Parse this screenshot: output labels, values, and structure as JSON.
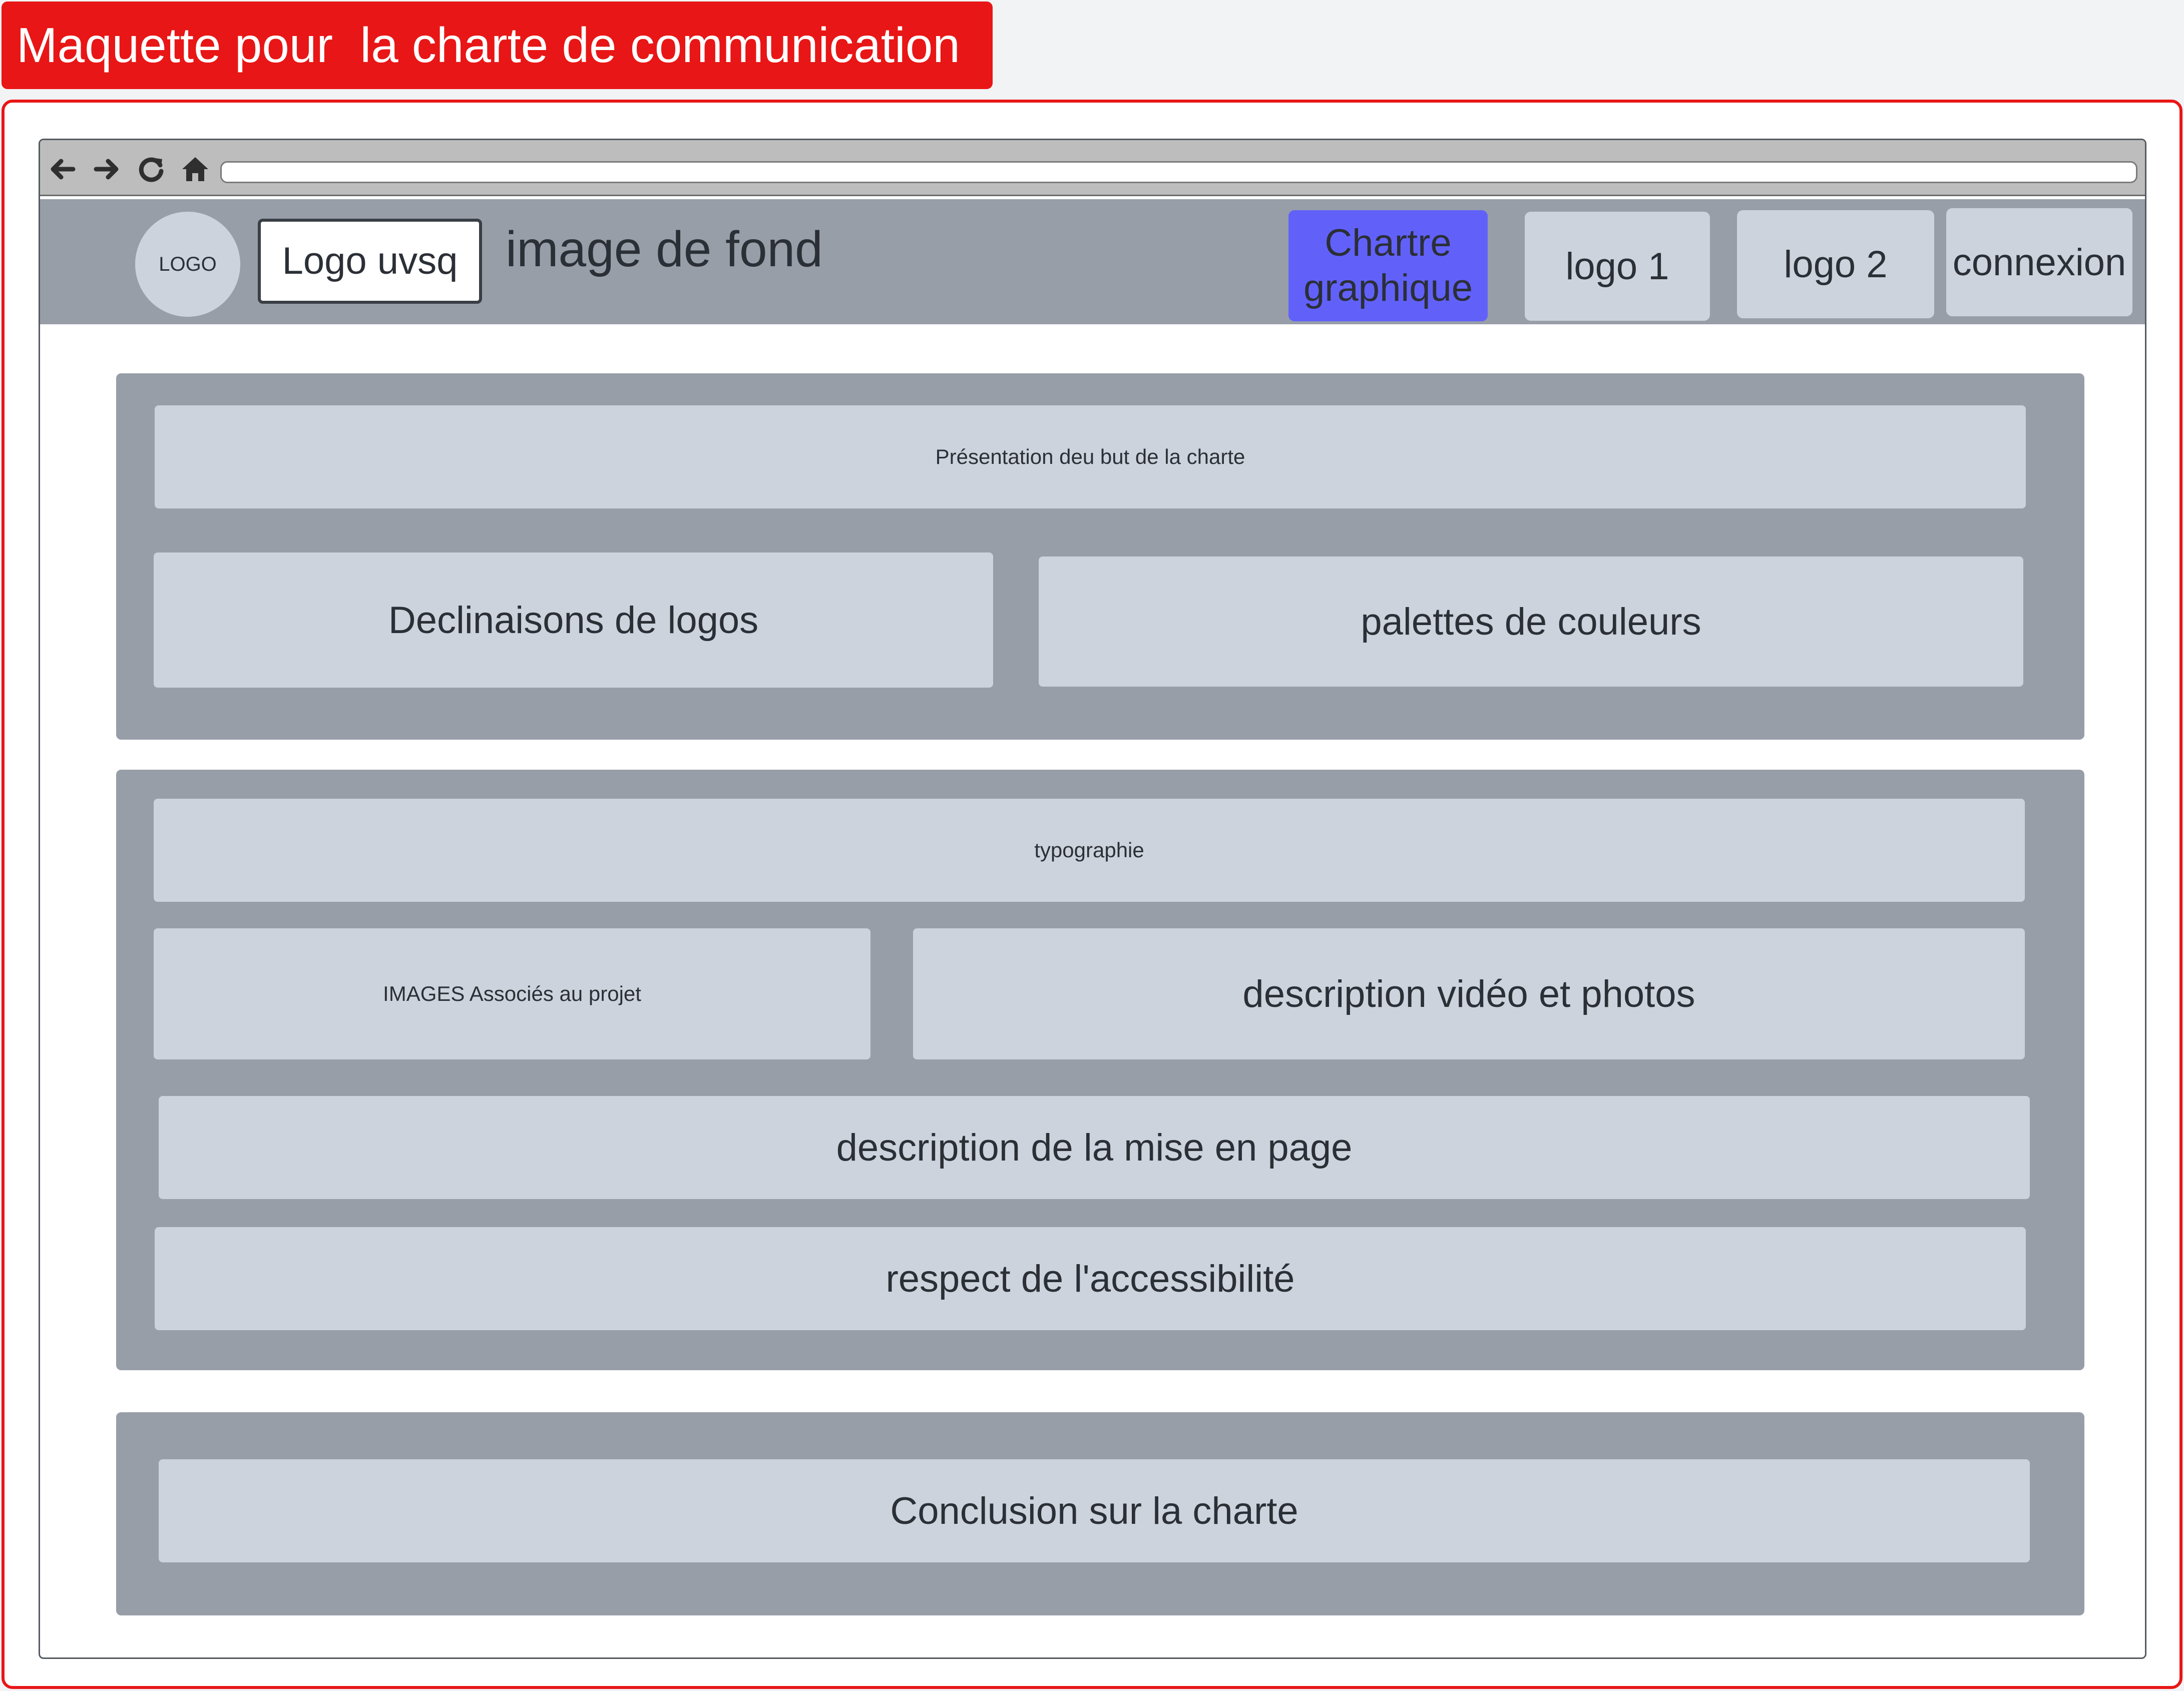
{
  "title": "Maquette pour  la charte de communication",
  "browser": {
    "nav_icons": [
      "back-arrow-icon",
      "forward-arrow-icon",
      "refresh-icon",
      "home-icon"
    ],
    "address_value": ""
  },
  "header": {
    "logo_circle": "LOGO",
    "logo_uvsq": "Logo uvsq",
    "background_label": "image de fond",
    "nav": {
      "chartre_line1": "Chartre",
      "chartre_line2": "graphique",
      "logo1": "logo 1",
      "logo2": "logo 2",
      "connexion": "connexion"
    }
  },
  "section1": {
    "presentation": "Présentation deu but  de la charte",
    "logos": "Declinaisons de logos",
    "palettes": "palettes de couleurs"
  },
  "section2": {
    "typographie": "typographie",
    "images": "IMAGES Associés au projet",
    "video": "description vidéo et photos",
    "mise_en_page": "description de la mise en page",
    "accessibilite": "respect de l'accessibilité"
  },
  "section3": {
    "conclusion": "Conclusion sur la charte"
  },
  "colors": {
    "accent_red": "#e81616",
    "active_nav": "#6161fa",
    "panel_gray": "#979ea8",
    "card_gray": "#cdd3dc"
  }
}
